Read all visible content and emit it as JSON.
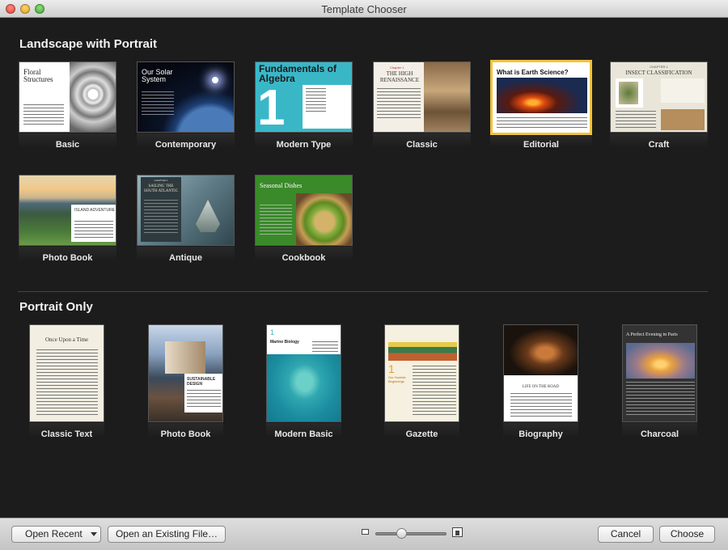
{
  "window": {
    "title": "Template Chooser"
  },
  "sections": {
    "landscape": {
      "title": "Landscape with Portrait"
    },
    "portrait": {
      "title": "Portrait Only"
    }
  },
  "landscape_templates": [
    {
      "label": "Basic",
      "heading": "Floral Structures"
    },
    {
      "label": "Contemporary",
      "heading": "Our Solar System"
    },
    {
      "label": "Modern Type",
      "heading": "Fundamentals of Algebra",
      "number": "1"
    },
    {
      "label": "Classic",
      "heading": "THE HIGH RENAISSANCE",
      "chapter": "Chapter 1"
    },
    {
      "label": "Editorial",
      "heading": "What is Earth Science?",
      "selected": true
    },
    {
      "label": "Craft",
      "heading": "INSECT CLASSIFICATION",
      "chapter": "CHAPTER 1"
    },
    {
      "label": "Photo Book",
      "heading": "ISLAND ADVENTURE"
    },
    {
      "label": "Antique",
      "heading": "SAILING THE SOUTH ATLANTIC",
      "chapter": "CHAPTER 1"
    },
    {
      "label": "Cookbook",
      "heading": "Seasonal Dishes"
    }
  ],
  "portrait_templates": [
    {
      "label": "Classic Text",
      "heading": "Once Upon a Time"
    },
    {
      "label": "Photo Book",
      "heading": "SUSTAINABLE DESIGN"
    },
    {
      "label": "Modern Basic",
      "heading": "Marine Biology",
      "number": "1"
    },
    {
      "label": "Gazette",
      "heading": "Our Humble Beginnings",
      "number": "1"
    },
    {
      "label": "Biography",
      "heading": "LIFE ON THE ROAD"
    },
    {
      "label": "Charcoal",
      "heading": "A Perfect Evening in Paris"
    }
  ],
  "toolbar": {
    "open_recent": "Open Recent",
    "open_existing": "Open an Existing File…",
    "cancel": "Cancel",
    "choose": "Choose",
    "zoom_level": 0.35
  },
  "colors": {
    "selection": "#f0c23a",
    "background": "#1c1c1c",
    "accent_teal": "#3ab7c7"
  },
  "icons": {
    "window_close": "close-icon",
    "window_min": "minimize-icon",
    "window_max": "zoom-icon",
    "dropdown": "chevron-down-icon",
    "small_thumb": "small-thumbnail-icon",
    "large_thumb": "large-thumbnail-icon"
  }
}
